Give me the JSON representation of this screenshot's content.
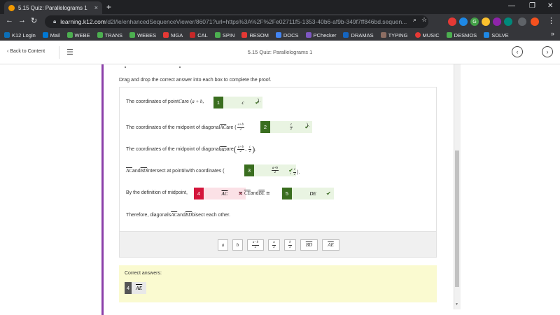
{
  "browser": {
    "tab_title": "5.15 Quiz: Parallelograms 1",
    "tab_close": "×",
    "new_tab": "+",
    "url_host": "learning.k12.com",
    "url_path": "/d2l/le/enhancedSequenceViewer/86071?url=https%3A%2F%2Fe02711f5-1353-40b6-af9b-349f7ff846bd.sequen...",
    "min": "—",
    "max": "❐",
    "close": "✕",
    "ext_g_label": "G",
    "bookmarks": [
      "K12 Login",
      "Mail",
      "WEBE",
      "TRANS",
      "WEBES",
      "MGA",
      "CAL",
      "SPIN",
      "RESOM",
      "DOCS",
      "PChecker",
      "DRAMAS",
      "TYPING",
      "MUSIC",
      "DESMOS",
      "SOLVE"
    ],
    "bookmarks_more": "»",
    "colors": {
      "chrome_dark": "#202124",
      "chrome_toolbar": "#35363a"
    }
  },
  "app": {
    "back_label": "Back to Content",
    "title": "5.15 Quiz: Parallelograms 1",
    "accent": "#8b3fa9"
  },
  "quiz": {
    "instruction": "Drag and drop the correct answer into each box to complete the proof.",
    "l1_pre": "The coordinates of point ",
    "l1_C": "C",
    "l1_mid": " are (",
    "l1_expr": "a + b,",
    "l1_post": ").",
    "l2_pre": "The coordinates of the midpoint of diagonal ",
    "l2_seg": "AC",
    "l2_mid": " are (",
    "l2_frac_num": "a+b",
    "l2_frac_den": "2",
    "l2_post": ").",
    "l3_pre": "The coordinates of the midpoint of diagonal ",
    "l3_seg": "BD",
    "l3_mid": " are ",
    "l3_open": "(",
    "l3_f1_num": "a+b",
    "l3_f1_den": "2",
    "l3_comma": ",",
    "l3_f2_num": "c",
    "l3_f2_den": "2",
    "l3_close": ")",
    "l3_post": ".",
    "l4_seg1": "AC",
    "l4_and": " and ",
    "l4_seg2": "BD",
    "l4_mid": " intersect at point ",
    "l4_E": "E",
    "l4_with": " with coordinates (",
    "l4_comma": ",",
    "l4_frac_num": "c",
    "l4_frac_den": "2",
    "l4_post": ").",
    "l5_pre": "By the definition of midpoint, ",
    "l5_cong1": "≅",
    "l5_seg_ce": "CE",
    "l5_and": " and ",
    "l5_seg_be": "BE",
    "l5_cong2": "≅",
    "l5_post": ".",
    "l6_pre": "Therefore, diagonals ",
    "l6_seg1": "AC",
    "l6_and": " and ",
    "l6_seg2": "BD",
    "l6_post": " bisect each other.",
    "boxes": [
      {
        "num": "1",
        "value": "c",
        "status": "correct"
      },
      {
        "num": "2",
        "value_num": "c",
        "value_den": "2",
        "status": "correct"
      },
      {
        "num": "3",
        "value_num": "a+b",
        "value_den": "2",
        "status": "correct"
      },
      {
        "num": "4",
        "value": "AC",
        "status": "incorrect"
      },
      {
        "num": "5",
        "value": "DE",
        "status": "correct"
      }
    ],
    "check_mark": "✔",
    "x_mark": "✕",
    "bank": {
      "a": "a",
      "b": "b",
      "f1_num": "a−b",
      "f1_den": "2",
      "f2_num": "a",
      "f2_den": "2",
      "f3_num": "b",
      "f3_den": "2",
      "bd": "BD",
      "ae": "AE"
    },
    "correct_label": "Correct answers:",
    "correct_answer": {
      "num": "4",
      "value": "AE"
    },
    "colors": {
      "ok": "#3a6e1f",
      "bad": "#d4163c",
      "panel": "#fafad0"
    }
  }
}
